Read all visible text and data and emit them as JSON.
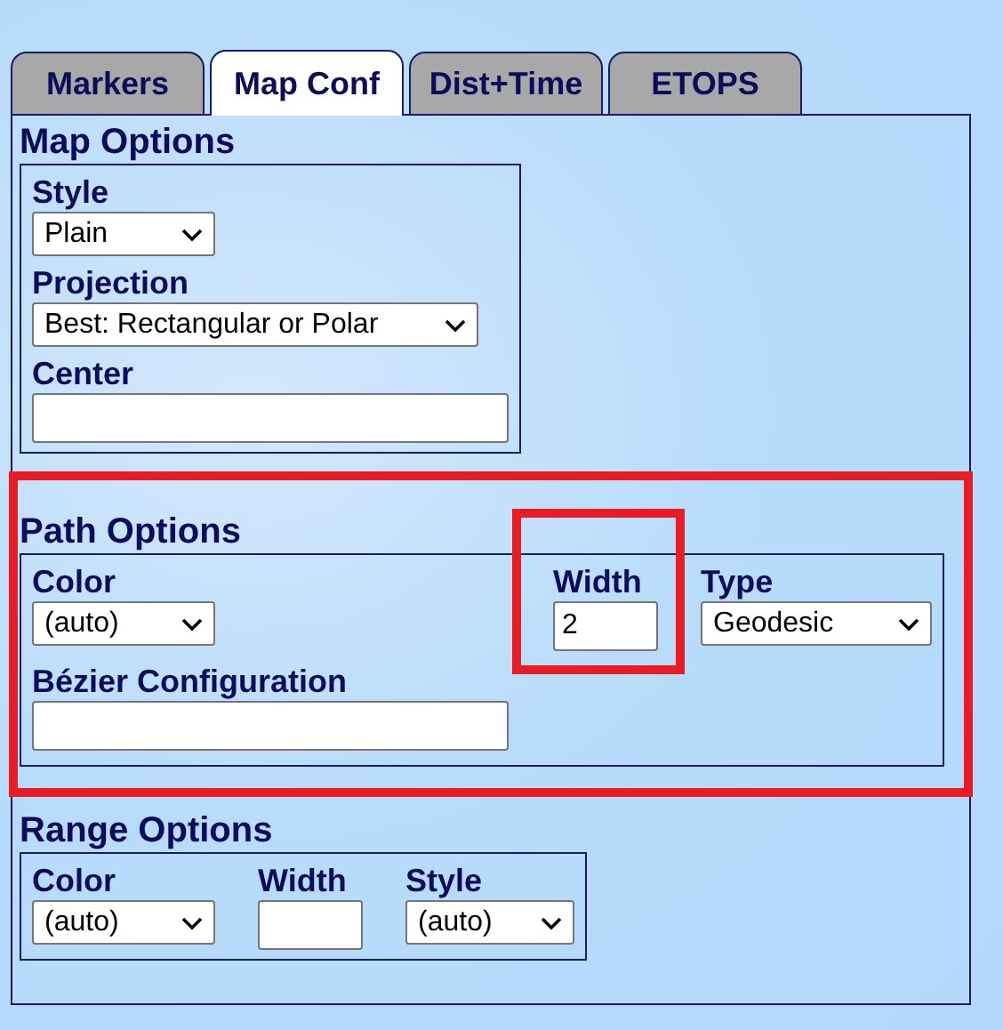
{
  "tabs": [
    {
      "label": "Markers",
      "selected": false
    },
    {
      "label": "Map Conf",
      "selected": true
    },
    {
      "label": "Dist+Time",
      "selected": false
    },
    {
      "label": "ETOPS",
      "selected": false
    }
  ],
  "sections": [
    {
      "title": "Map Options",
      "highlighted": false,
      "rows": [
        [
          {
            "kind": "select",
            "label": "Style",
            "value": "Plain",
            "highlighted": false
          }
        ],
        [
          {
            "kind": "select",
            "label": "Projection",
            "value": "Best: Rectangular or Polar",
            "highlighted": false
          }
        ],
        [
          {
            "kind": "text",
            "label": "Center",
            "highlighted": false
          }
        ]
      ]
    },
    {
      "title": "Path Options",
      "highlighted": true,
      "rows": [
        [
          {
            "kind": "select",
            "label": "Color",
            "value": "(auto)",
            "highlighted": false
          },
          {
            "kind": "text",
            "label": "Width",
            "value": "2",
            "highlighted": true
          },
          {
            "kind": "select",
            "label": "Type",
            "value": "Geodesic",
            "highlighted": false
          }
        ],
        [
          {
            "kind": "text",
            "label": "Bézier Configuration",
            "highlighted": false
          }
        ]
      ]
    },
    {
      "title": "Range Options",
      "highlighted": false,
      "rows": [
        [
          {
            "kind": "select",
            "label": "Color",
            "value": "(auto)",
            "highlighted": false
          },
          {
            "kind": "text",
            "label": "Width",
            "highlighted": false
          },
          {
            "kind": "select",
            "label": "Style",
            "value": "(auto)",
            "highlighted": false
          }
        ]
      ]
    }
  ]
}
